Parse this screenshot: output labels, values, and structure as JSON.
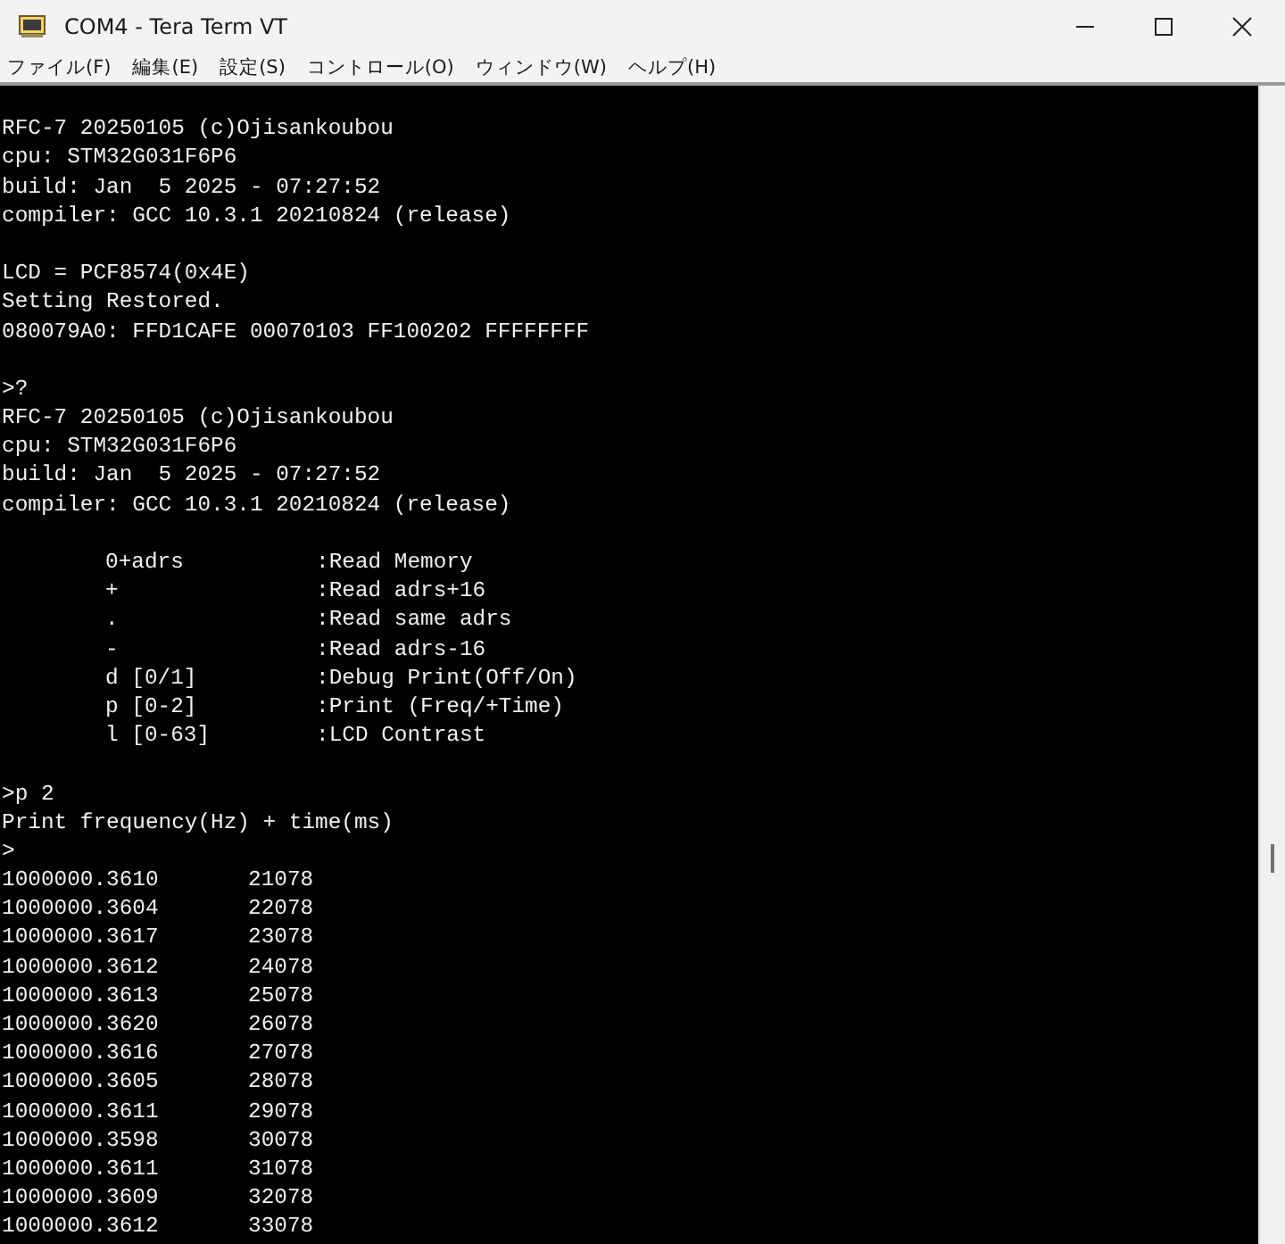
{
  "window": {
    "title": "COM4 - Tera Term VT"
  },
  "menu": [
    "ファイル(F)",
    "編集(E)",
    "設定(S)",
    "コントロール(O)",
    "ウィンドウ(W)",
    "ヘルプ(H)"
  ],
  "terminal": {
    "blocks": [
      {
        "kind": "text",
        "lines": [
          "RFC-7 20250105 (c)Ojisankoubou",
          "cpu: STM32G031F6P6",
          "build: Jan  5 2025 - 07:27:52",
          "compiler: GCC 10.3.1 20210824 (release)"
        ]
      },
      {
        "kind": "text",
        "lines": [
          "LCD = PCF8574(0x4E)",
          "Setting Restored.",
          "080079A0: FFD1CAFE 00070103 FF100202 FFFFFFFF"
        ]
      },
      {
        "kind": "text",
        "lines": [
          ">?",
          "RFC-7 20250105 (c)Ojisankoubou",
          "cpu: STM32G031F6P6",
          "build: Jan  5 2025 - 07:27:52",
          "compiler: GCC 10.3.1 20210824 (release)"
        ]
      },
      {
        "kind": "help",
        "rows": [
          {
            "command": "0+adrs",
            "description": ":Read Memory"
          },
          {
            "command": "+",
            "description": ":Read adrs+16"
          },
          {
            "command": ".",
            "description": ":Read same adrs"
          },
          {
            "command": "-",
            "description": ":Read adrs-16"
          },
          {
            "command": "d [0/1]",
            "description": ":Debug Print(Off/On)"
          },
          {
            "command": "p [0-2]",
            "description": ":Print (Freq/+Time)"
          },
          {
            "command": "l [0-63]",
            "description": ":LCD Contrast"
          }
        ]
      },
      {
        "kind": "text",
        "lines": [
          ">p 2",
          "Print frequency(Hz) + time(ms)",
          ">"
        ]
      },
      {
        "kind": "readings",
        "rows": [
          {
            "frequency": "1000000.3610",
            "time": "21078"
          },
          {
            "frequency": "1000000.3604",
            "time": "22078"
          },
          {
            "frequency": "1000000.3617",
            "time": "23078"
          },
          {
            "frequency": "1000000.3612",
            "time": "24078"
          },
          {
            "frequency": "1000000.3613",
            "time": "25078"
          },
          {
            "frequency": "1000000.3620",
            "time": "26078"
          },
          {
            "frequency": "1000000.3616",
            "time": "27078"
          },
          {
            "frequency": "1000000.3605",
            "time": "28078"
          },
          {
            "frequency": "1000000.3611",
            "time": "29078"
          },
          {
            "frequency": "1000000.3598",
            "time": "30078"
          },
          {
            "frequency": "1000000.3611",
            "time": "31078"
          },
          {
            "frequency": "1000000.3609",
            "time": "32078"
          },
          {
            "frequency": "1000000.3612",
            "time": "33078"
          }
        ]
      }
    ]
  }
}
